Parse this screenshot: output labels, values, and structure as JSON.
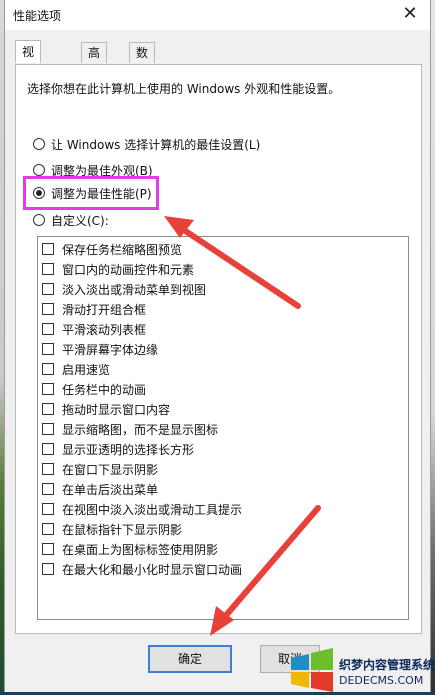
{
  "window": {
    "title": "性能选项",
    "close_icon": "close-icon"
  },
  "tabs": [
    {
      "label": "视觉效果",
      "active": true
    },
    {
      "label": "高级",
      "active": false
    },
    {
      "label": "数据执行保护",
      "active": false
    }
  ],
  "description": "选择你想在此计算机上使用的 Windows 外观和性能设置。",
  "radio_options": [
    {
      "label": "让 Windows 选择计算机的最佳设置(L)",
      "selected": false
    },
    {
      "label": "调整为最佳外观(B)",
      "selected": false
    },
    {
      "label": "调整为最佳性能(P)",
      "selected": true
    },
    {
      "label": "自定义(C):",
      "selected": false
    }
  ],
  "effects": [
    {
      "label": "保存任务栏缩略图预览",
      "checked": false
    },
    {
      "label": "窗口内的动画控件和元素",
      "checked": false
    },
    {
      "label": "淡入淡出或滑动菜单到视图",
      "checked": false
    },
    {
      "label": "滑动打开组合框",
      "checked": false
    },
    {
      "label": "平滑滚动列表框",
      "checked": false
    },
    {
      "label": "平滑屏幕字体边缘",
      "checked": false
    },
    {
      "label": "启用速览",
      "checked": false
    },
    {
      "label": "任务栏中的动画",
      "checked": false
    },
    {
      "label": "拖动时显示窗口内容",
      "checked": false
    },
    {
      "label": "显示缩略图，而不是显示图标",
      "checked": false
    },
    {
      "label": "显示亚透明的选择长方形",
      "checked": false
    },
    {
      "label": "在窗口下显示阴影",
      "checked": false
    },
    {
      "label": "在单击后淡出菜单",
      "checked": false
    },
    {
      "label": "在视图中淡入淡出或滑动工具提示",
      "checked": false
    },
    {
      "label": "在鼠标指针下显示阴影",
      "checked": false
    },
    {
      "label": "在桌面上为图标标签使用阴影",
      "checked": false
    },
    {
      "label": "在最大化和最小化时显示窗口动画",
      "checked": false
    }
  ],
  "buttons": {
    "ok": "确定",
    "cancel": "取消"
  },
  "watermark": {
    "name": "织梦内容管理系统",
    "url": "DEDECMS.COM"
  },
  "colors": {
    "highlight": "#e23ce6",
    "arrow": "#e8413a",
    "ok_border": "#3c7fd6"
  }
}
